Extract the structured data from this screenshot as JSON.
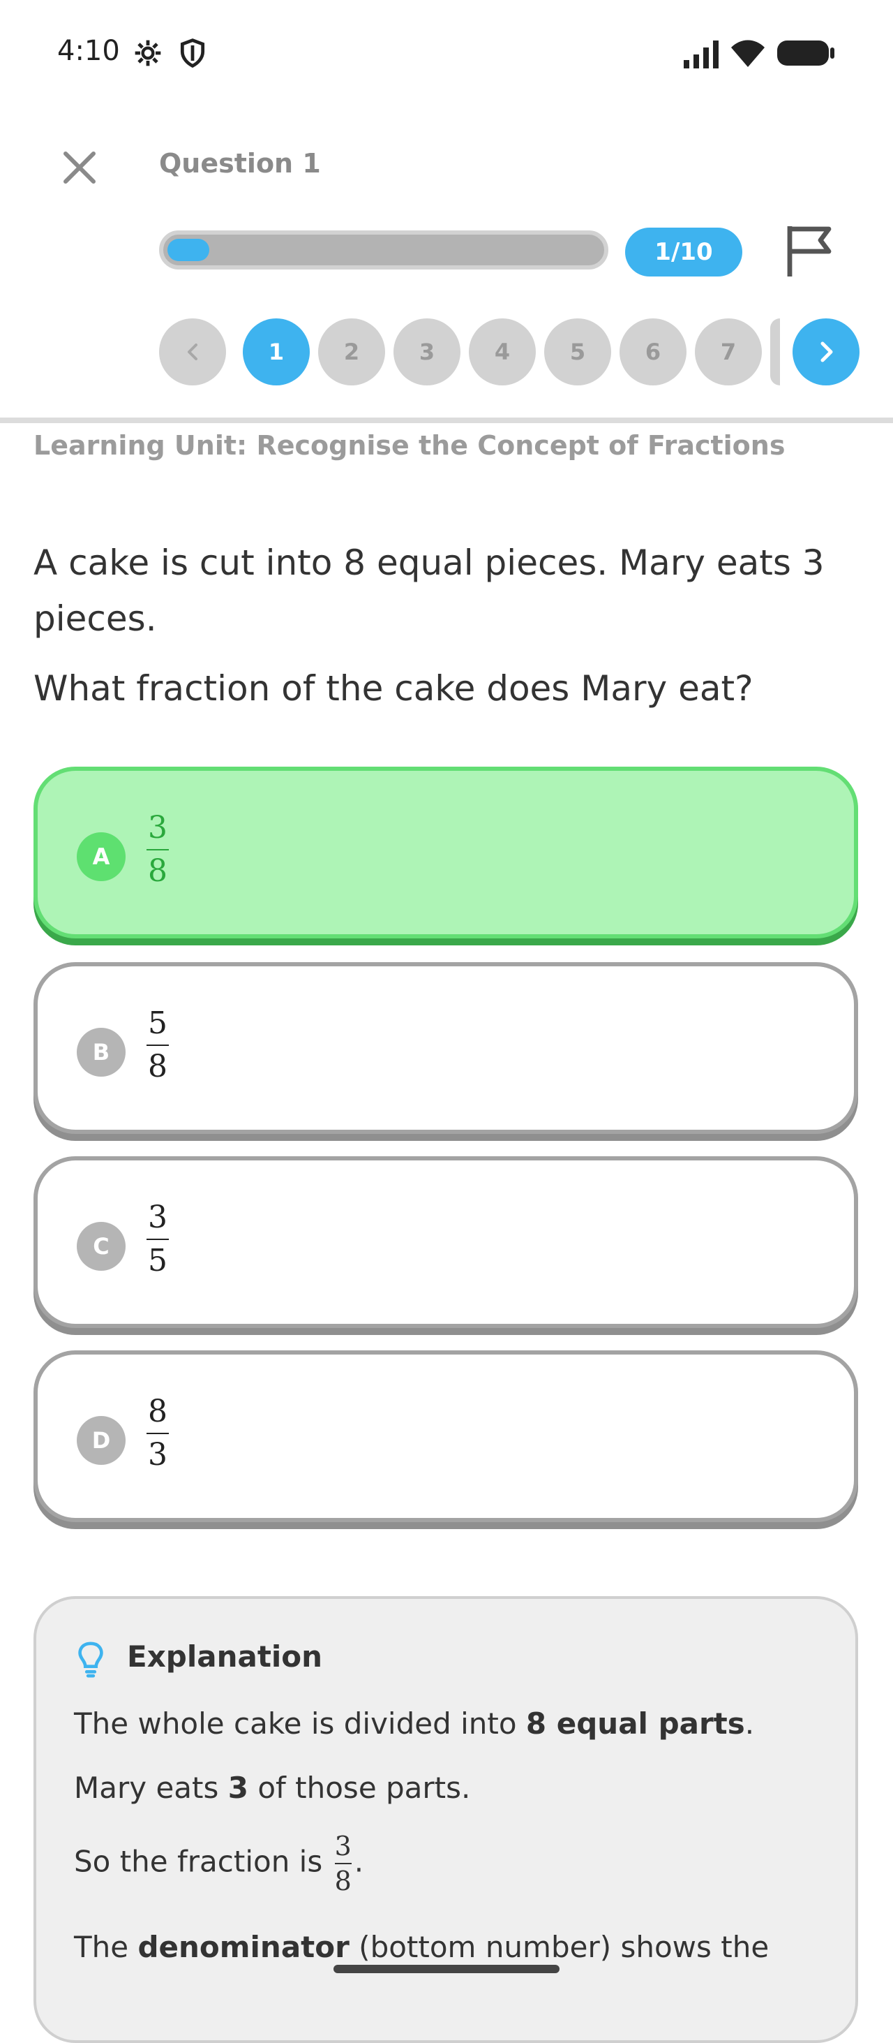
{
  "status_bar": {
    "time": "4:10"
  },
  "header": {
    "title": "Question 1",
    "progress_fraction": 0.1,
    "counter": "1/10"
  },
  "nav": {
    "prev_label": "<",
    "next_label": ">",
    "items": [
      {
        "label": "1",
        "active": true
      },
      {
        "label": "2",
        "active": false
      },
      {
        "label": "3",
        "active": false
      },
      {
        "label": "4",
        "active": false
      },
      {
        "label": "5",
        "active": false
      },
      {
        "label": "6",
        "active": false
      },
      {
        "label": "7",
        "active": false
      }
    ]
  },
  "unit": "Learning Unit: Recognise the Concept of Fractions",
  "question": {
    "line1": "A cake is cut into 8 equal pieces. Mary eats 3 pieces.",
    "line2": "What fraction of the cake does Mary eat?"
  },
  "options": [
    {
      "letter": "A",
      "numerator": "3",
      "denominator": "8",
      "state": "correct"
    },
    {
      "letter": "B",
      "numerator": "5",
      "denominator": "8",
      "state": "default"
    },
    {
      "letter": "C",
      "numerator": "3",
      "denominator": "5",
      "state": "default"
    },
    {
      "letter": "D",
      "numerator": "8",
      "denominator": "3",
      "state": "default"
    }
  ],
  "explanation": {
    "title": "Explanation",
    "l1_pre": "The whole cake is divided into ",
    "l1_bold": "8 equal parts",
    "l1_post": ".",
    "l2_pre": "Mary eats ",
    "l2_bold": "3",
    "l2_post": " of those parts.",
    "l3_pre": "So the fraction is ",
    "l3_num": "3",
    "l3_den": "8",
    "l3_post": ".",
    "l4_pre": "The ",
    "l4_bold": "denominator",
    "l4_post": " (bottom number) shows the"
  },
  "colors": {
    "accent": "#3eb3ef",
    "correct_bg": "#aef4b6",
    "correct_border": "#63de74"
  }
}
